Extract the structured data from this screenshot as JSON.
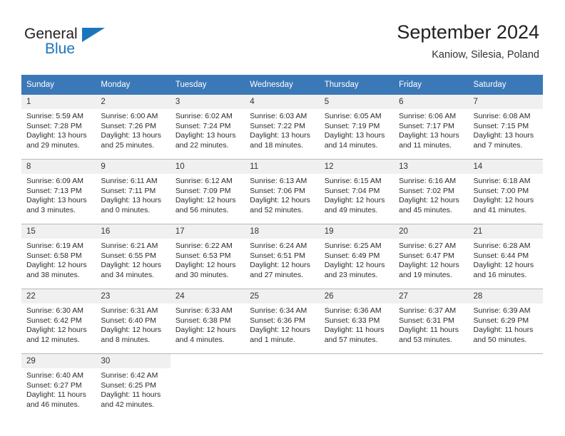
{
  "brand": {
    "name_top": "General",
    "name_bottom": "Blue"
  },
  "header": {
    "title": "September 2024",
    "subtitle": "Kaniow, Silesia, Poland"
  },
  "colors": {
    "header_blue": "#3b78b7",
    "brand_blue": "#1b75bb",
    "daynum_bg": "#f0f0f0",
    "grid_line": "#b9b9b9"
  },
  "calendar": {
    "weekday_headers": [
      "Sunday",
      "Monday",
      "Tuesday",
      "Wednesday",
      "Thursday",
      "Friday",
      "Saturday"
    ],
    "weeks": [
      [
        {
          "day": "1",
          "sunrise": "Sunrise: 5:59 AM",
          "sunset": "Sunset: 7:28 PM",
          "daylight": "Daylight: 13 hours and 29 minutes."
        },
        {
          "day": "2",
          "sunrise": "Sunrise: 6:00 AM",
          "sunset": "Sunset: 7:26 PM",
          "daylight": "Daylight: 13 hours and 25 minutes."
        },
        {
          "day": "3",
          "sunrise": "Sunrise: 6:02 AM",
          "sunset": "Sunset: 7:24 PM",
          "daylight": "Daylight: 13 hours and 22 minutes."
        },
        {
          "day": "4",
          "sunrise": "Sunrise: 6:03 AM",
          "sunset": "Sunset: 7:22 PM",
          "daylight": "Daylight: 13 hours and 18 minutes."
        },
        {
          "day": "5",
          "sunrise": "Sunrise: 6:05 AM",
          "sunset": "Sunset: 7:19 PM",
          "daylight": "Daylight: 13 hours and 14 minutes."
        },
        {
          "day": "6",
          "sunrise": "Sunrise: 6:06 AM",
          "sunset": "Sunset: 7:17 PM",
          "daylight": "Daylight: 13 hours and 11 minutes."
        },
        {
          "day": "7",
          "sunrise": "Sunrise: 6:08 AM",
          "sunset": "Sunset: 7:15 PM",
          "daylight": "Daylight: 13 hours and 7 minutes."
        }
      ],
      [
        {
          "day": "8",
          "sunrise": "Sunrise: 6:09 AM",
          "sunset": "Sunset: 7:13 PM",
          "daylight": "Daylight: 13 hours and 3 minutes."
        },
        {
          "day": "9",
          "sunrise": "Sunrise: 6:11 AM",
          "sunset": "Sunset: 7:11 PM",
          "daylight": "Daylight: 13 hours and 0 minutes."
        },
        {
          "day": "10",
          "sunrise": "Sunrise: 6:12 AM",
          "sunset": "Sunset: 7:09 PM",
          "daylight": "Daylight: 12 hours and 56 minutes."
        },
        {
          "day": "11",
          "sunrise": "Sunrise: 6:13 AM",
          "sunset": "Sunset: 7:06 PM",
          "daylight": "Daylight: 12 hours and 52 minutes."
        },
        {
          "day": "12",
          "sunrise": "Sunrise: 6:15 AM",
          "sunset": "Sunset: 7:04 PM",
          "daylight": "Daylight: 12 hours and 49 minutes."
        },
        {
          "day": "13",
          "sunrise": "Sunrise: 6:16 AM",
          "sunset": "Sunset: 7:02 PM",
          "daylight": "Daylight: 12 hours and 45 minutes."
        },
        {
          "day": "14",
          "sunrise": "Sunrise: 6:18 AM",
          "sunset": "Sunset: 7:00 PM",
          "daylight": "Daylight: 12 hours and 41 minutes."
        }
      ],
      [
        {
          "day": "15",
          "sunrise": "Sunrise: 6:19 AM",
          "sunset": "Sunset: 6:58 PM",
          "daylight": "Daylight: 12 hours and 38 minutes."
        },
        {
          "day": "16",
          "sunrise": "Sunrise: 6:21 AM",
          "sunset": "Sunset: 6:55 PM",
          "daylight": "Daylight: 12 hours and 34 minutes."
        },
        {
          "day": "17",
          "sunrise": "Sunrise: 6:22 AM",
          "sunset": "Sunset: 6:53 PM",
          "daylight": "Daylight: 12 hours and 30 minutes."
        },
        {
          "day": "18",
          "sunrise": "Sunrise: 6:24 AM",
          "sunset": "Sunset: 6:51 PM",
          "daylight": "Daylight: 12 hours and 27 minutes."
        },
        {
          "day": "19",
          "sunrise": "Sunrise: 6:25 AM",
          "sunset": "Sunset: 6:49 PM",
          "daylight": "Daylight: 12 hours and 23 minutes."
        },
        {
          "day": "20",
          "sunrise": "Sunrise: 6:27 AM",
          "sunset": "Sunset: 6:47 PM",
          "daylight": "Daylight: 12 hours and 19 minutes."
        },
        {
          "day": "21",
          "sunrise": "Sunrise: 6:28 AM",
          "sunset": "Sunset: 6:44 PM",
          "daylight": "Daylight: 12 hours and 16 minutes."
        }
      ],
      [
        {
          "day": "22",
          "sunrise": "Sunrise: 6:30 AM",
          "sunset": "Sunset: 6:42 PM",
          "daylight": "Daylight: 12 hours and 12 minutes."
        },
        {
          "day": "23",
          "sunrise": "Sunrise: 6:31 AM",
          "sunset": "Sunset: 6:40 PM",
          "daylight": "Daylight: 12 hours and 8 minutes."
        },
        {
          "day": "24",
          "sunrise": "Sunrise: 6:33 AM",
          "sunset": "Sunset: 6:38 PM",
          "daylight": "Daylight: 12 hours and 4 minutes."
        },
        {
          "day": "25",
          "sunrise": "Sunrise: 6:34 AM",
          "sunset": "Sunset: 6:36 PM",
          "daylight": "Daylight: 12 hours and 1 minute."
        },
        {
          "day": "26",
          "sunrise": "Sunrise: 6:36 AM",
          "sunset": "Sunset: 6:33 PM",
          "daylight": "Daylight: 11 hours and 57 minutes."
        },
        {
          "day": "27",
          "sunrise": "Sunrise: 6:37 AM",
          "sunset": "Sunset: 6:31 PM",
          "daylight": "Daylight: 11 hours and 53 minutes."
        },
        {
          "day": "28",
          "sunrise": "Sunrise: 6:39 AM",
          "sunset": "Sunset: 6:29 PM",
          "daylight": "Daylight: 11 hours and 50 minutes."
        }
      ],
      [
        {
          "day": "29",
          "sunrise": "Sunrise: 6:40 AM",
          "sunset": "Sunset: 6:27 PM",
          "daylight": "Daylight: 11 hours and 46 minutes."
        },
        {
          "day": "30",
          "sunrise": "Sunrise: 6:42 AM",
          "sunset": "Sunset: 6:25 PM",
          "daylight": "Daylight: 11 hours and 42 minutes."
        },
        {
          "day": "",
          "sunrise": "",
          "sunset": "",
          "daylight": ""
        },
        {
          "day": "",
          "sunrise": "",
          "sunset": "",
          "daylight": ""
        },
        {
          "day": "",
          "sunrise": "",
          "sunset": "",
          "daylight": ""
        },
        {
          "day": "",
          "sunrise": "",
          "sunset": "",
          "daylight": ""
        },
        {
          "day": "",
          "sunrise": "",
          "sunset": "",
          "daylight": ""
        }
      ]
    ]
  }
}
